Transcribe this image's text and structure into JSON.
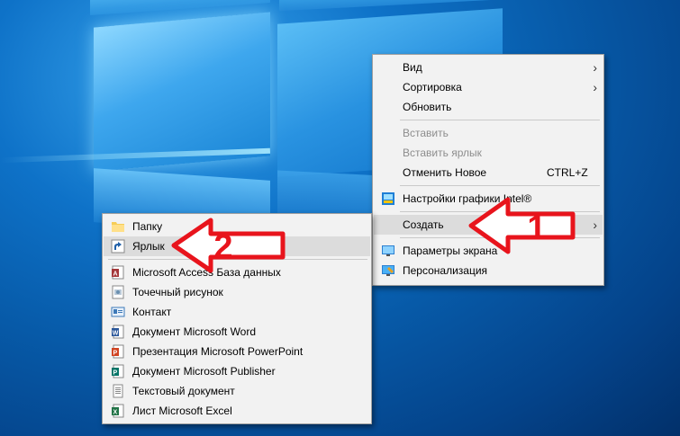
{
  "context_menu": {
    "items": [
      {
        "label": "Вид"
      },
      {
        "label": "Сортировка"
      },
      {
        "label": "Обновить"
      },
      {
        "label": "Вставить"
      },
      {
        "label": "Вставить ярлык"
      },
      {
        "label": "Отменить Новое",
        "shortcut": "CTRL+Z"
      },
      {
        "label": "Настройки графики Intel®"
      },
      {
        "label": "Создать"
      },
      {
        "label": "Параметры экрана"
      },
      {
        "label": "Персонализация"
      }
    ]
  },
  "submenu": {
    "items": [
      {
        "label": "Папку",
        "icon": "folder-icon"
      },
      {
        "label": "Ярлык",
        "icon": "shortcut-icon"
      },
      {
        "label": "Microsoft Access База данных",
        "icon": "access-icon"
      },
      {
        "label": "Точечный рисунок",
        "icon": "bitmap-icon"
      },
      {
        "label": "Контакт",
        "icon": "contact-icon"
      },
      {
        "label": "Документ Microsoft Word",
        "icon": "word-icon"
      },
      {
        "label": "Презентация Microsoft PowerPoint",
        "icon": "powerpoint-icon"
      },
      {
        "label": "Документ Microsoft Publisher",
        "icon": "publisher-icon"
      },
      {
        "label": "Текстовый документ",
        "icon": "text-document-icon"
      },
      {
        "label": "Лист Microsoft Excel",
        "icon": "excel-icon"
      }
    ]
  },
  "annotations": [
    {
      "number": "1"
    },
    {
      "number": "2"
    }
  ],
  "colors": {
    "arrow": "#e8141c",
    "desktop": "#0a63b8"
  }
}
